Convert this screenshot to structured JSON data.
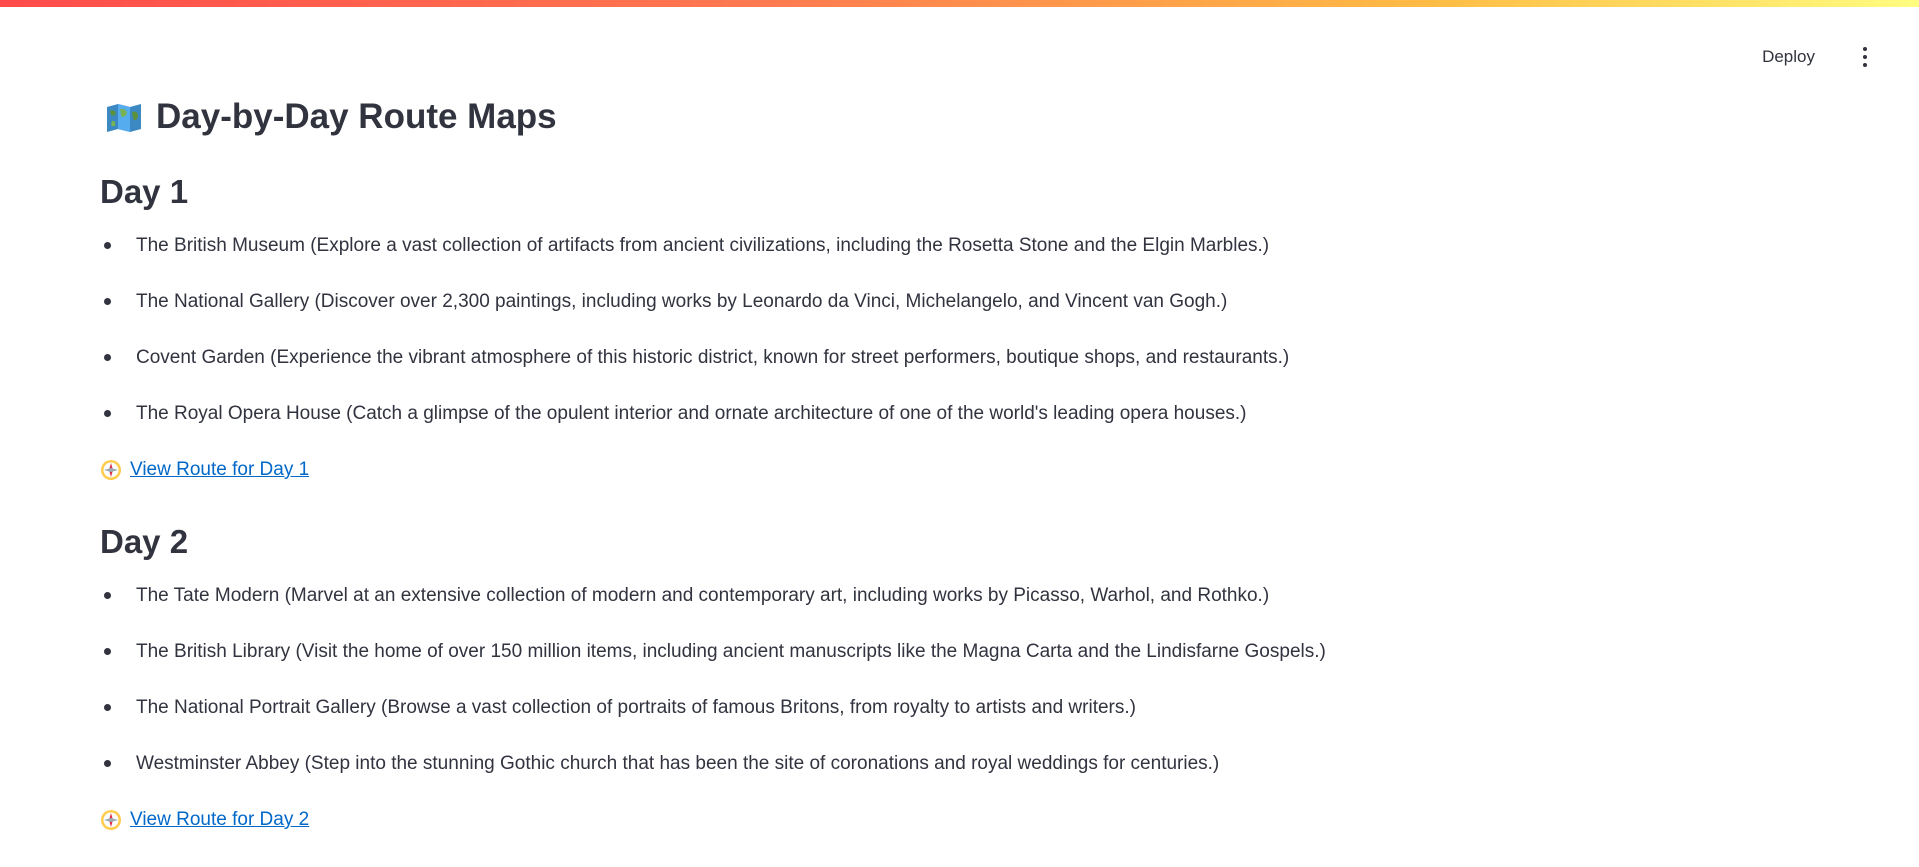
{
  "header": {
    "deploy_label": "Deploy",
    "menu_icon": "more-vertical-icon"
  },
  "page": {
    "title": "Day-by-Day Route Maps",
    "title_icon": "world-map-icon"
  },
  "days": [
    {
      "heading": "Day 1",
      "places": [
        "The British Museum (Explore a vast collection of artifacts from ancient civilizations, including the Rosetta Stone and the Elgin Marbles.)",
        "The National Gallery (Discover over 2,300 paintings, including works by Leonardo da Vinci, Michelangelo, and Vincent van Gogh.)",
        "Covent Garden (Experience the vibrant atmosphere of this historic district, known for street performers, boutique shops, and restaurants.)",
        "The Royal Opera House (Catch a glimpse of the opulent interior and ornate architecture of one of the world's leading opera houses.)"
      ],
      "route_link": "View Route for Day 1"
    },
    {
      "heading": "Day 2",
      "places": [
        "The Tate Modern (Marvel at an extensive collection of modern and contemporary art, including works by Picasso, Warhol, and Rothko.)",
        "The British Library (Visit the home of over 150 million items, including ancient manuscripts like the Magna Carta and the Lindisfarne Gospels.)",
        "The National Portrait Gallery (Browse a vast collection of portraits of famous Britons, from royalty to artists and writers.)",
        "Westminster Abbey (Step into the stunning Gothic church that has been the site of coronations and royal weddings for centuries.)"
      ],
      "route_link": "View Route for Day 2"
    }
  ],
  "colors": {
    "text": "#31333f",
    "link": "#0068c9",
    "decoration_start": "#ff4b4b",
    "decoration_end": "#fffd80"
  }
}
